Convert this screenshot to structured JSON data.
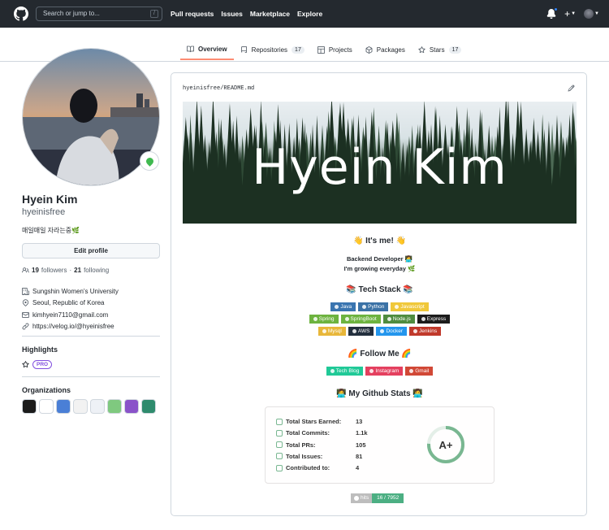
{
  "header": {
    "search_placeholder": "Search or jump to...",
    "search_shortcut": "/",
    "nav": [
      "Pull requests",
      "Issues",
      "Marketplace",
      "Explore"
    ]
  },
  "tabs": [
    {
      "label": "Overview",
      "count": "",
      "icon": "book-icon"
    },
    {
      "label": "Repositories",
      "count": "17",
      "icon": "repo-icon"
    },
    {
      "label": "Projects",
      "count": "",
      "icon": "project-icon"
    },
    {
      "label": "Packages",
      "count": "",
      "icon": "package-icon"
    },
    {
      "label": "Stars",
      "count": "17",
      "icon": "star-icon"
    }
  ],
  "profile": {
    "name": "Hyein Kim",
    "login": "hyeinisfree",
    "bio": "매일매일 자라는중🌿",
    "edit_label": "Edit profile",
    "followers": "19",
    "followers_label": "followers",
    "following": "21",
    "following_label": "following",
    "organization": "Sungshin Women's University",
    "location": "Seoul, Republic of Korea",
    "email": "kimhyein7110@gmail.com",
    "website": "https://velog.io/@hyeinisfree",
    "highlights_title": "Highlights",
    "pro_label": "PRO",
    "orgs_title": "Organizations",
    "orgs_colors": [
      "#1b1b1b",
      "#ffffff",
      "#4a7fd6",
      "#f2f2f2",
      "#eef1f6",
      "#7fc97f",
      "#8a53c9",
      "#2e8b6d"
    ]
  },
  "readme": {
    "path_user": "hyeinisfree",
    "path_sep": "/",
    "path_file": "README.md",
    "banner_title": "Hyein Kim",
    "its_me": "👋 It's me! 👋",
    "line1": "Backend Developer 👩‍💻",
    "line2": "I'm growing everyday 🌿",
    "tech_title": "📚 Tech Stack 📚",
    "tech_row1": [
      {
        "label": "Java",
        "color": "#3a75b0"
      },
      {
        "label": "Python",
        "color": "#3b72a6"
      },
      {
        "label": "Javascript",
        "color": "#f0c83a"
      }
    ],
    "tech_row2": [
      {
        "label": "Spring",
        "color": "#6db33f"
      },
      {
        "label": "SpringBoot",
        "color": "#6db33f"
      },
      {
        "label": "Node.js",
        "color": "#4f8c3f"
      },
      {
        "label": "Express",
        "color": "#1c1c1c"
      }
    ],
    "tech_row3": [
      {
        "label": "Mysql",
        "color": "#e8b73a"
      },
      {
        "label": "AWS",
        "color": "#232f3e"
      },
      {
        "label": "Docker",
        "color": "#2496ed"
      },
      {
        "label": "Jenkins",
        "color": "#c0392b"
      }
    ],
    "follow_title": "🌈 Follow Me 🌈",
    "follow_badges": [
      {
        "label": "Tech Blog",
        "color": "#20c997"
      },
      {
        "label": "Instagram",
        "color": "#e4405f"
      },
      {
        "label": "Gmail",
        "color": "#d14836"
      }
    ],
    "stats_title": "👩‍💻 My Github Stats 👩‍💻",
    "stats": [
      {
        "label": "Total Stars Earned:",
        "value": "13",
        "icon": "star-icon"
      },
      {
        "label": "Total Commits:",
        "value": "1.1k",
        "icon": "history-icon"
      },
      {
        "label": "Total PRs:",
        "value": "105",
        "icon": "pull-request-icon"
      },
      {
        "label": "Total Issues:",
        "value": "81",
        "icon": "issue-icon"
      },
      {
        "label": "Contributed to:",
        "value": "4",
        "icon": "repo-icon"
      }
    ],
    "rank": "A+",
    "rank_color": "#79b791",
    "hits_label": "hits",
    "hits_value": "16 / 7952"
  }
}
